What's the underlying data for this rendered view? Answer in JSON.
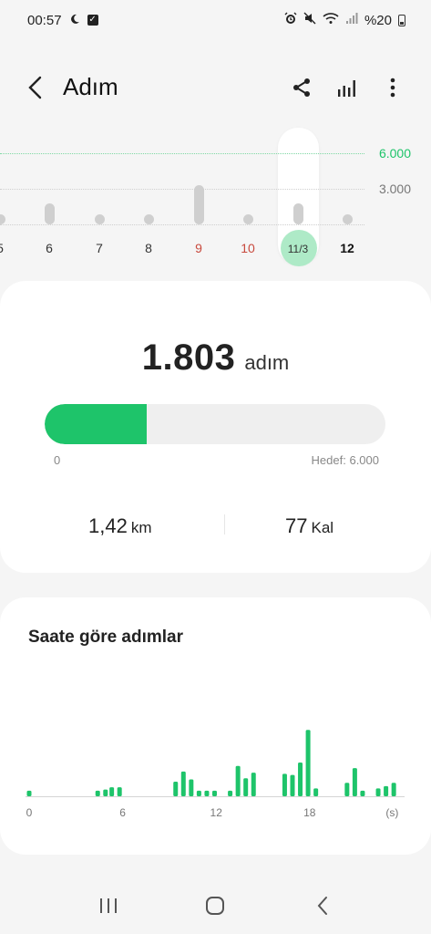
{
  "status_bar": {
    "time": "00:57",
    "battery_text": "%20",
    "icons": [
      "moon-icon",
      "checkbox-icon",
      "alarm-icon",
      "mute-icon",
      "wifi-icon",
      "signal-icon",
      "battery-icon"
    ]
  },
  "app_bar": {
    "title": "Adım",
    "icons": [
      "back-icon",
      "share-icon",
      "chart-icon",
      "more-icon"
    ]
  },
  "day_strip": {
    "goal_label": "6.000",
    "ref_label": "3.000",
    "goal_value": 6000,
    "ref_value": 3000,
    "days": [
      {
        "label": "5",
        "steps": 600,
        "color": "normal"
      },
      {
        "label": "6",
        "steps": 1800,
        "color": "normal"
      },
      {
        "label": "7",
        "steps": 600,
        "color": "normal"
      },
      {
        "label": "8",
        "steps": 600,
        "color": "normal"
      },
      {
        "label": "9",
        "steps": 3300,
        "color": "red"
      },
      {
        "label": "10",
        "steps": 600,
        "color": "red"
      },
      {
        "label": "11/3",
        "steps": 1803,
        "color": "selected"
      },
      {
        "label": "12",
        "steps": 600,
        "color": "bold"
      }
    ]
  },
  "summary": {
    "steps_value": "1.803",
    "steps_unit": "adım",
    "progress_fraction": 0.3,
    "progress_min": "0",
    "progress_goal": "Hedef: 6.000",
    "distance_value": "1,42",
    "distance_unit": "km",
    "calories_value": "77",
    "calories_unit": "Kal",
    "accent_color": "#1ec46a"
  },
  "hourly": {
    "title": "Saate göre adımlar",
    "x_tick_labels": [
      "0",
      "6",
      "12",
      "18",
      "(s)"
    ],
    "x_tick_hours": [
      0,
      6,
      12,
      18,
      23.3
    ],
    "bars": [
      {
        "hour": 0,
        "value": 5
      },
      {
        "hour": 4.4,
        "value": 5
      },
      {
        "hour": 4.9,
        "value": 6
      },
      {
        "hour": 5.3,
        "value": 8
      },
      {
        "hour": 5.8,
        "value": 8
      },
      {
        "hour": 9.4,
        "value": 13
      },
      {
        "hour": 9.9,
        "value": 22
      },
      {
        "hour": 10.4,
        "value": 15
      },
      {
        "hour": 10.9,
        "value": 5
      },
      {
        "hour": 11.4,
        "value": 5
      },
      {
        "hour": 11.9,
        "value": 5
      },
      {
        "hour": 12.9,
        "value": 5
      },
      {
        "hour": 13.4,
        "value": 27
      },
      {
        "hour": 13.9,
        "value": 16
      },
      {
        "hour": 14.4,
        "value": 21
      },
      {
        "hour": 16.4,
        "value": 20
      },
      {
        "hour": 16.9,
        "value": 19
      },
      {
        "hour": 17.4,
        "value": 30
      },
      {
        "hour": 17.9,
        "value": 59
      },
      {
        "hour": 18.4,
        "value": 7
      },
      {
        "hour": 20.4,
        "value": 12
      },
      {
        "hour": 20.9,
        "value": 25
      },
      {
        "hour": 21.4,
        "value": 5
      },
      {
        "hour": 22.4,
        "value": 7
      },
      {
        "hour": 22.9,
        "value": 9
      },
      {
        "hour": 23.4,
        "value": 12
      }
    ]
  },
  "nav_bar": {
    "icons": [
      "recent-apps-icon",
      "home-icon",
      "back-nav-icon"
    ]
  }
}
